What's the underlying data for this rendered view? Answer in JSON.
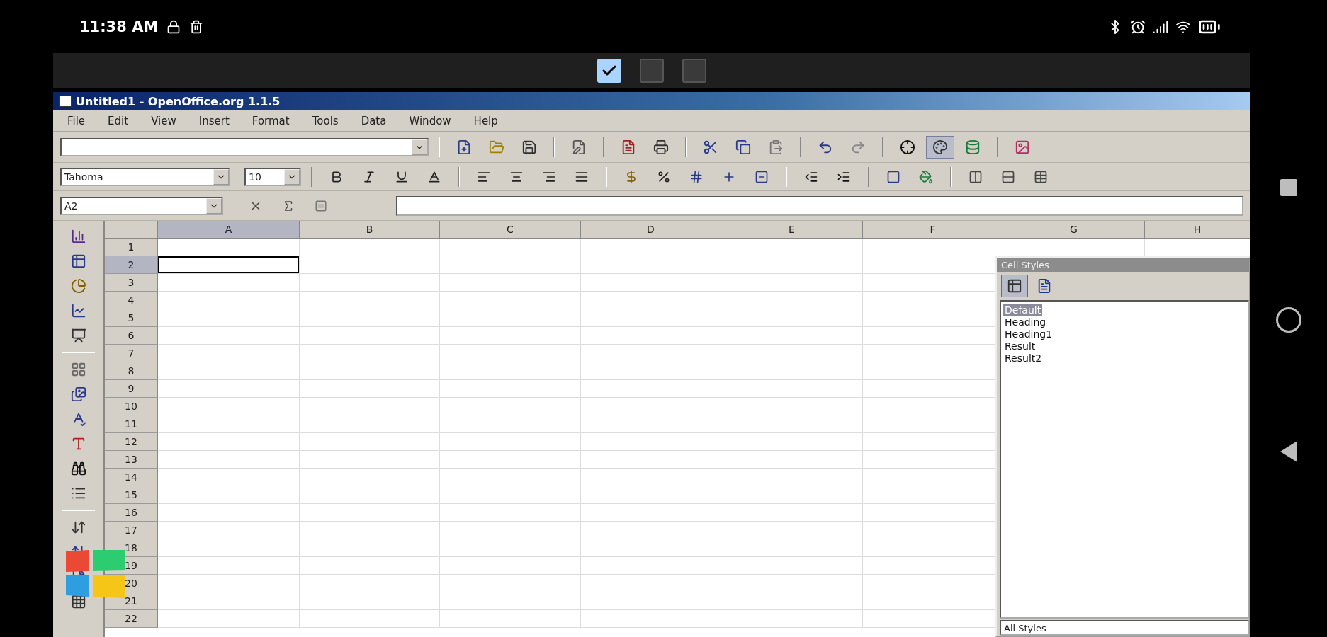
{
  "status_bar": {
    "time": "11:38 AM"
  },
  "screen_switcher": [
    {
      "checked": true
    },
    {
      "checked": false
    },
    {
      "checked": false
    }
  ],
  "window": {
    "title": "Untitled1 - OpenOffice.org 1.1.5"
  },
  "menu": [
    "File",
    "Edit",
    "View",
    "Insert",
    "Format",
    "Tools",
    "Data",
    "Window",
    "Help"
  ],
  "main_toolbar": {
    "stylist_on": true
  },
  "formatting": {
    "font": "Tahoma",
    "size": "10"
  },
  "formula_bar": {
    "cell_reference": "A2"
  },
  "sheet": {
    "columns": [
      {
        "label": "A",
        "selected": true
      },
      {
        "label": "B",
        "selected": false
      },
      {
        "label": "C",
        "selected": false
      },
      {
        "label": "D",
        "selected": false
      },
      {
        "label": "E",
        "selected": false
      },
      {
        "label": "F",
        "selected": false
      },
      {
        "label": "G",
        "selected": false
      },
      {
        "label": "H",
        "selected": false
      }
    ],
    "rows": [
      {
        "label": "1",
        "selected": false
      },
      {
        "label": "2",
        "selected": true
      },
      {
        "label": "3",
        "selected": false
      },
      {
        "label": "4",
        "selected": false
      },
      {
        "label": "5",
        "selected": false
      },
      {
        "label": "6",
        "selected": false
      },
      {
        "label": "7",
        "selected": false
      },
      {
        "label": "8",
        "selected": false
      },
      {
        "label": "9",
        "selected": false
      },
      {
        "label": "10",
        "selected": false
      },
      {
        "label": "11",
        "selected": false
      },
      {
        "label": "12",
        "selected": false
      },
      {
        "label": "13",
        "selected": false
      },
      {
        "label": "14",
        "selected": false
      },
      {
        "label": "15",
        "selected": false
      },
      {
        "label": "16",
        "selected": false
      },
      {
        "label": "17",
        "selected": false
      },
      {
        "label": "18",
        "selected": false
      },
      {
        "label": "19",
        "selected": false
      },
      {
        "label": "20",
        "selected": false
      },
      {
        "label": "21",
        "selected": false
      },
      {
        "label": "22",
        "selected": false
      }
    ]
  },
  "stylist": {
    "title": "Cell Styles",
    "style_types": [
      {
        "selected": true
      },
      {
        "selected": false
      }
    ],
    "styles": [
      {
        "label": "Default",
        "selected": true
      },
      {
        "label": "Heading",
        "selected": false
      },
      {
        "label": "Heading1",
        "selected": false
      },
      {
        "label": "Result",
        "selected": false
      },
      {
        "label": "Result2",
        "selected": false
      }
    ],
    "filter": "All Styles"
  }
}
